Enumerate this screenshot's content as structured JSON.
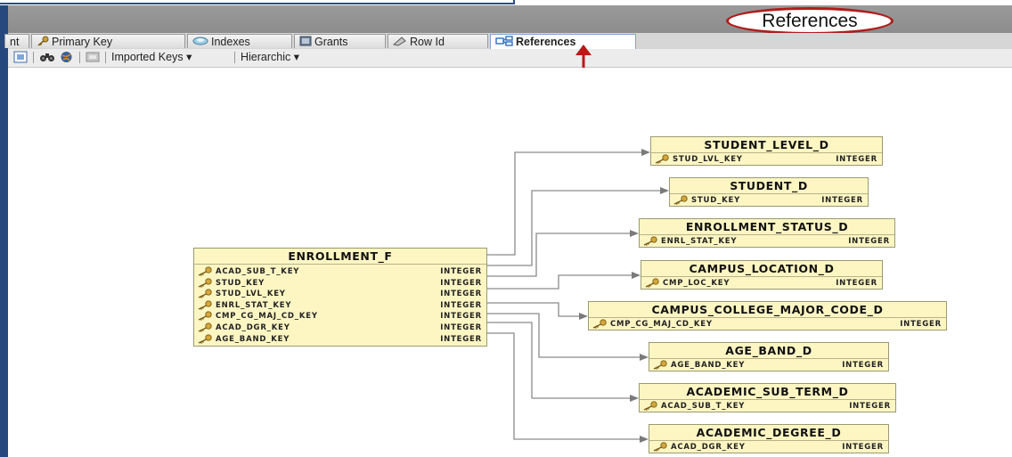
{
  "callouts": {
    "references": "References",
    "click": "click"
  },
  "tabs": [
    {
      "label": "nt"
    },
    {
      "label": "Primary Key",
      "icon": "key-icon"
    },
    {
      "label": "Indexes",
      "icon": "index-icon"
    },
    {
      "label": "Grants",
      "icon": "grants-icon"
    },
    {
      "label": "Row Id",
      "icon": "rowid-icon"
    },
    {
      "label": "References",
      "icon": "references-icon",
      "active": true
    }
  ],
  "toolbar": {
    "imported_keys": "Imported Keys",
    "hierarchic": "Hierarchic"
  },
  "main_entity": {
    "name": "ENROLLMENT_F",
    "columns": [
      {
        "name": "ACAD_SUB_T_KEY",
        "type": "INTEGER"
      },
      {
        "name": "STUD_KEY",
        "type": "INTEGER"
      },
      {
        "name": "STUD_LVL_KEY",
        "type": "INTEGER"
      },
      {
        "name": "ENRL_STAT_KEY",
        "type": "INTEGER"
      },
      {
        "name": "CMP_CG_MAJ_CD_KEY",
        "type": "INTEGER"
      },
      {
        "name": "ACAD_DGR_KEY",
        "type": "INTEGER"
      },
      {
        "name": "AGE_BAND_KEY",
        "type": "INTEGER"
      }
    ]
  },
  "referenced": [
    {
      "name": "STUDENT_LEVEL_D",
      "key": "STUD_LVL_KEY",
      "type": "INTEGER"
    },
    {
      "name": "STUDENT_D",
      "key": "STUD_KEY",
      "type": "INTEGER"
    },
    {
      "name": "ENROLLMENT_STATUS_D",
      "key": "ENRL_STAT_KEY",
      "type": "INTEGER"
    },
    {
      "name": "CAMPUS_LOCATION_D",
      "key": "CMP_LOC_KEY",
      "type": "INTEGER"
    },
    {
      "name": "CAMPUS_COLLEGE_MAJOR_CODE_D",
      "key": "CMP_CG_MAJ_CD_KEY",
      "type": "INTEGER"
    },
    {
      "name": "AGE_BAND_D",
      "key": "AGE_BAND_KEY",
      "type": "INTEGER"
    },
    {
      "name": "ACADEMIC_SUB_TERM_D",
      "key": "ACAD_SUB_T_KEY",
      "type": "INTEGER"
    },
    {
      "name": "ACADEMIC_DEGREE_D",
      "key": "ACAD_DGR_KEY",
      "type": "INTEGER"
    }
  ],
  "colors": {
    "entity_fill": "#fdf6c3",
    "callout_border": "#b01c1c",
    "header": "#8c8c8c",
    "frame": "#27487f"
  }
}
